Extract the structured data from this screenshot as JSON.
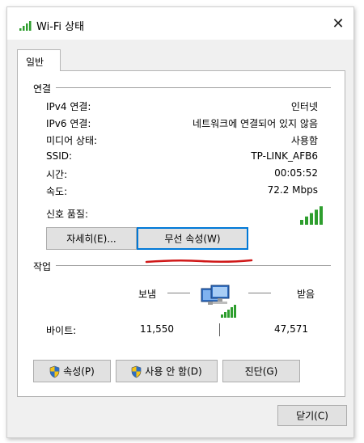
{
  "window": {
    "title": "Wi-Fi 상태",
    "close_glyph": "✕"
  },
  "tabs": [
    {
      "label": "일반"
    }
  ],
  "connection": {
    "section_title": "연결",
    "rows": [
      {
        "label": "IPv4 연결:",
        "value": "인터넷"
      },
      {
        "label": "IPv6 연결:",
        "value": "네트워크에 연결되어 있지 않음"
      },
      {
        "label": "미디어 상태:",
        "value": "사용함"
      },
      {
        "label": "SSID:",
        "value": "TP-LINK_AFB6"
      },
      {
        "label": "시간:",
        "value": "00:05:52"
      },
      {
        "label": "속도:",
        "value": "72.2 Mbps"
      }
    ],
    "signal_label": "신호 품질:",
    "signal_level": 1.0,
    "details_button": "자세히(E)...",
    "wireless_props_button": "무선 속성(W)"
  },
  "activity": {
    "section_title": "작업",
    "sent_label": "보냄",
    "received_label": "받음",
    "bytes_label": "바이트:",
    "bytes_sent": "11,550",
    "bytes_received": "47,571"
  },
  "actions": {
    "properties_button": "속성(P)",
    "disable_button": "사용 안 함(D)",
    "diagnose_button": "진단(G)"
  },
  "footer": {
    "close_button": "닫기(C)"
  },
  "colors": {
    "accent": "#0078d7",
    "signal": "#2e9e2e",
    "annotation": "#d01818"
  },
  "icons": {
    "title": "wifi-signal-icon",
    "network": "network-computer-icon",
    "shield": "uac-shield-icon"
  }
}
